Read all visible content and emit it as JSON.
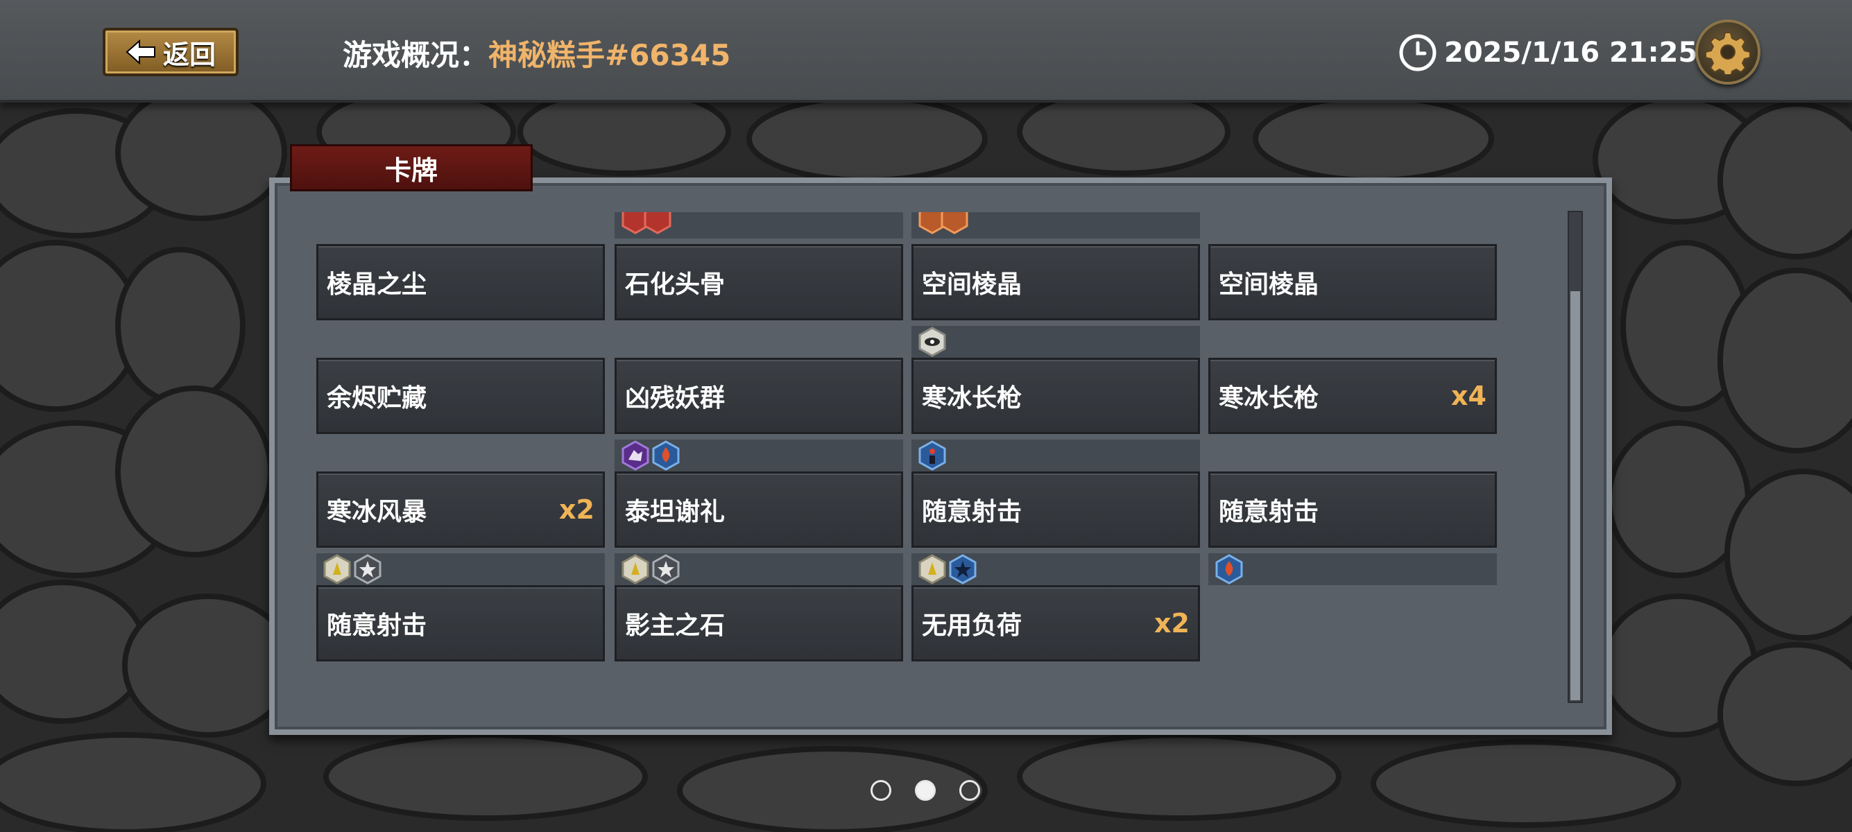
{
  "header": {
    "back_label": "返回",
    "title_label": "游戏概况：",
    "title_name": "神秘糕手#66345",
    "datetime": "2025/1/16 21:25"
  },
  "panel": {
    "tab_label": "卡牌"
  },
  "cards": [
    {
      "name": "棱晶之尘",
      "count": ""
    },
    {
      "name": "石化头骨",
      "count": ""
    },
    {
      "name": "空间棱晶",
      "count": ""
    },
    {
      "name": "空间棱晶",
      "count": ""
    },
    {
      "name": "余烬贮藏",
      "count": ""
    },
    {
      "name": "凶残妖群",
      "count": ""
    },
    {
      "name": "寒冰长枪",
      "count": ""
    },
    {
      "name": "寒冰长枪",
      "count": "x4"
    },
    {
      "name": "寒冰风暴",
      "count": "x2"
    },
    {
      "name": "泰坦谢礼",
      "count": ""
    },
    {
      "name": "随意射击",
      "count": ""
    },
    {
      "name": "随意射击",
      "count": ""
    },
    {
      "name": "随意射击",
      "count": ""
    },
    {
      "name": "影主之石",
      "count": ""
    },
    {
      "name": "无用负荷",
      "count": "x2"
    }
  ],
  "icon_strips": [
    {
      "icons": [
        "red-rune-icon",
        "red-rune-icon"
      ]
    },
    {
      "icons": [
        "orange-rune-icon",
        "orange-rune-icon"
      ]
    },
    {
      "icons": [
        "eye-hex-icon"
      ]
    },
    {
      "icons": [
        "purple-beast-hex-icon",
        "blue-fire-hex-icon"
      ]
    },
    {
      "icons": [
        "blue-figure-hex-icon"
      ]
    },
    {
      "icons": [
        "gold-figure-hex-icon",
        "silver-star-hex-icon"
      ]
    },
    {
      "icons": [
        "gold-figure-hex-icon",
        "silver-star-hex-icon"
      ]
    },
    {
      "icons": [
        "gold-figure-hex-icon",
        "blue-star-hex-icon"
      ]
    },
    {
      "icons": [
        "blue-fire-hex-icon"
      ]
    }
  ],
  "pagination": {
    "pages": 3,
    "current": 2
  },
  "colors": {
    "title_name": "#f0b46a",
    "count": "#f0b456",
    "tab": "#6e1b16"
  }
}
